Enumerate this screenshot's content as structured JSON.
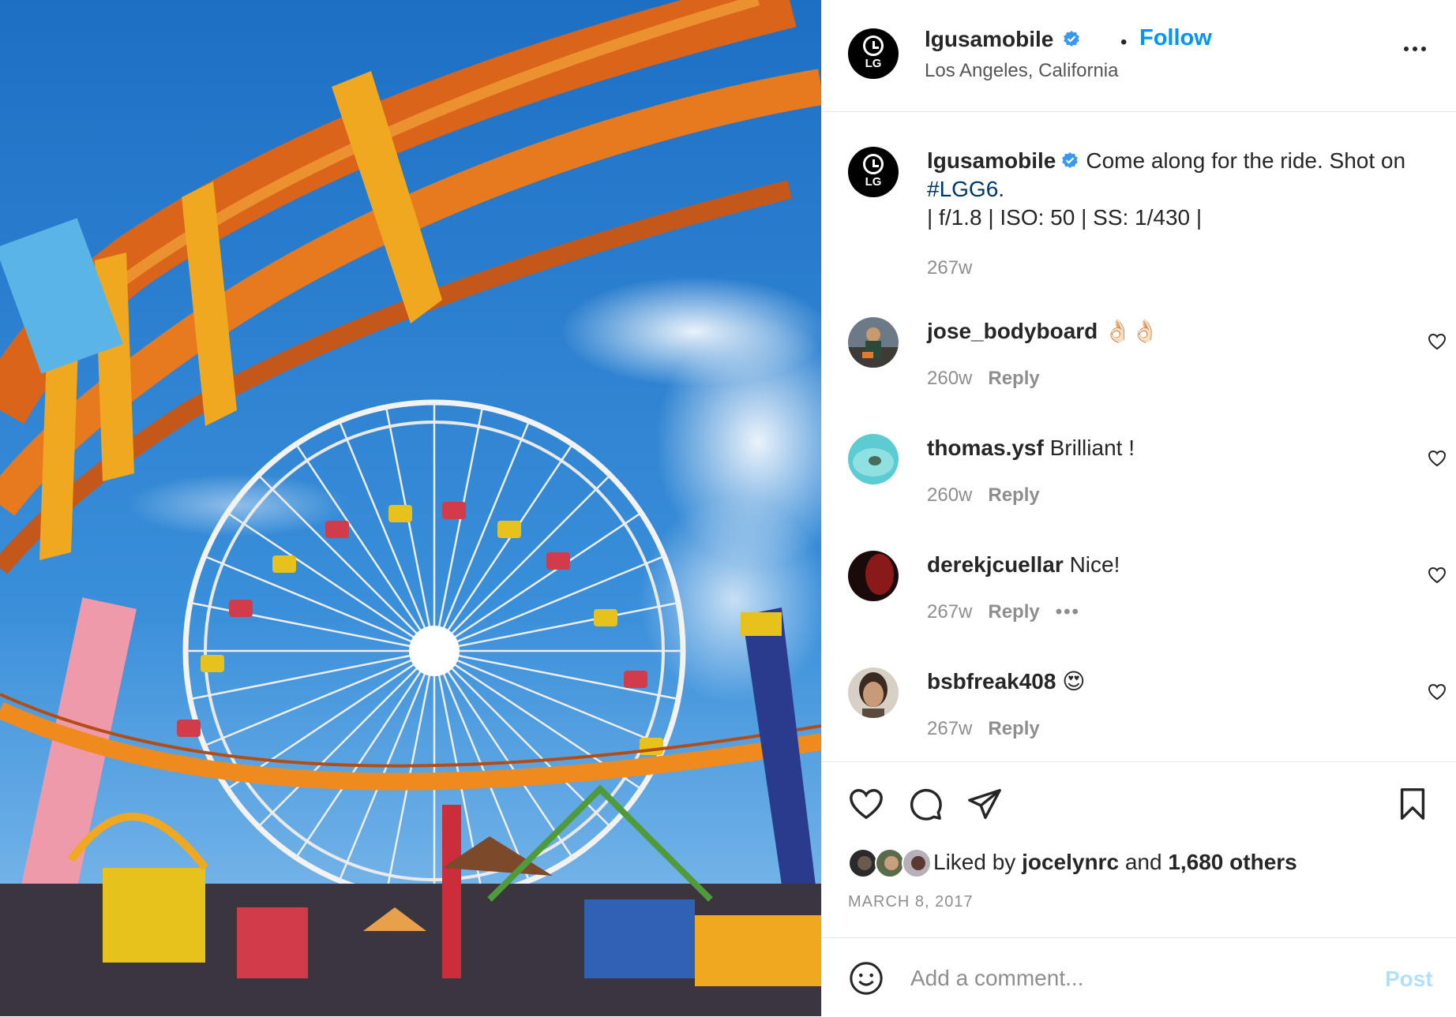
{
  "photo": {
    "alt_icon": "amusement-park-photo"
  },
  "header": {
    "username": "lgusamobile",
    "separator": "•",
    "follow_label": "Follow",
    "location": "Los Angeles, California",
    "avatar_text": "LG",
    "more_icon": "more-horizontal-icon"
  },
  "caption": {
    "username": "lgusamobile",
    "text": "Come along for the ride. Shot on",
    "hashtag": "#LGG6",
    "after_hashtag": ".",
    "line2": "| f/1.8 | ISO: 50 | SS: 1/430 |",
    "time": "267w",
    "avatar_text": "LG"
  },
  "comments": [
    {
      "username": "jose_bodyboard",
      "text": "👌🏻👌🏻",
      "time": "260w",
      "reply": "Reply"
    },
    {
      "username": "thomas.ysf",
      "text": "Brilliant !",
      "time": "260w",
      "reply": "Reply"
    },
    {
      "username": "derekjcuellar",
      "text": "Nice!",
      "time": "267w",
      "reply": "Reply",
      "more": "•••"
    },
    {
      "username": "bsbfreak408",
      "text": "😍",
      "time": "267w",
      "reply": "Reply"
    }
  ],
  "likes": {
    "prefix": "Liked by",
    "user": "jocelynrc",
    "middle": "and",
    "others": "1,680 others"
  },
  "date": "MARCH 8, 2017",
  "add_comment": {
    "placeholder": "Add a comment...",
    "post_label": "Post"
  },
  "colors": {
    "accent": "#0095f6",
    "post_disabled": "#b2dffc",
    "verified": "#3897f0",
    "hashtag": "#00376b"
  }
}
